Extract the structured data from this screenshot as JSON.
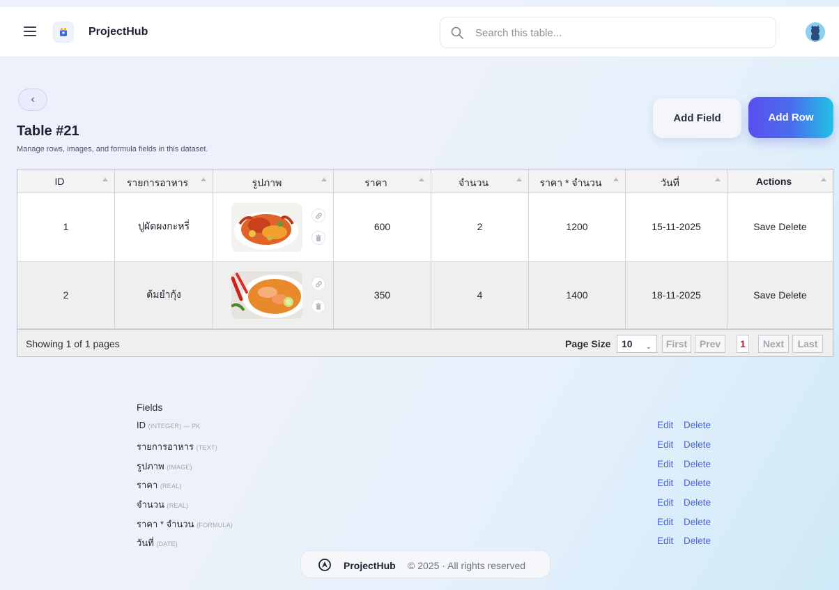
{
  "header": {
    "brand": "ProjectHub",
    "search_placeholder": "Search this table..."
  },
  "page": {
    "back_label": "‹",
    "title": "Table #21",
    "subtitle": "Manage rows, images, and formula fields in this dataset.",
    "add_field_label": "Add Field",
    "add_row_label": "Add Row"
  },
  "table": {
    "columns": [
      "ID",
      "รายการอาหาร",
      "รูปภาพ",
      "ราคา",
      "จำนวน",
      "ราคา * จำนวน",
      "วันที่",
      "Actions"
    ],
    "rows": [
      {
        "id": "1",
        "name": "ปูผัดผงกะหรี่",
        "price": "600",
        "qty": "2",
        "total": "1200",
        "date": "15-11-2025",
        "save": "Save",
        "delete": "Delete"
      },
      {
        "id": "2",
        "name": "ต้มยำกุ้ง",
        "price": "350",
        "qty": "4",
        "total": "1400",
        "date": "18-11-2025",
        "save": "Save",
        "delete": "Delete"
      }
    ],
    "footer": {
      "showing": "Showing 1 of 1 pages",
      "page_size_label": "Page Size",
      "page_size_value": "10",
      "first": "First",
      "prev": "Prev",
      "current_page": "1",
      "next": "Next",
      "last": "Last"
    }
  },
  "fields": {
    "heading": "Fields",
    "items": [
      {
        "name": "ID",
        "type": "(INTEGER) — PK",
        "edit": "Edit",
        "delete": "Delete"
      },
      {
        "name": "รายการอาหาร",
        "type": "(TEXT)",
        "edit": "Edit",
        "delete": "Delete"
      },
      {
        "name": "รูปภาพ",
        "type": "(IMAGE)",
        "edit": "Edit",
        "delete": "Delete"
      },
      {
        "name": "ราคา",
        "type": "(REAL)",
        "edit": "Edit",
        "delete": "Delete"
      },
      {
        "name": "จำนวน",
        "type": "(REAL)",
        "edit": "Edit",
        "delete": "Delete"
      },
      {
        "name": "ราคา * จำนวน",
        "type": "(FORMULA)",
        "edit": "Edit",
        "delete": "Delete"
      },
      {
        "name": "วันที่",
        "type": "(DATE)",
        "edit": "Edit",
        "delete": "Delete"
      }
    ]
  },
  "footer": {
    "brand": "ProjectHub",
    "copyright": "© 2025 · All rights reserved"
  },
  "colors": {
    "accent": "#4c63d2",
    "add_row_gradient_start": "#5b4ff0",
    "add_row_gradient_end": "#22c2e6",
    "current_page": "#c0202a"
  },
  "icons": [
    "menu-icon",
    "logo-icon",
    "search-icon",
    "avatar",
    "link-icon",
    "trash-icon",
    "chevron-down-icon"
  ]
}
